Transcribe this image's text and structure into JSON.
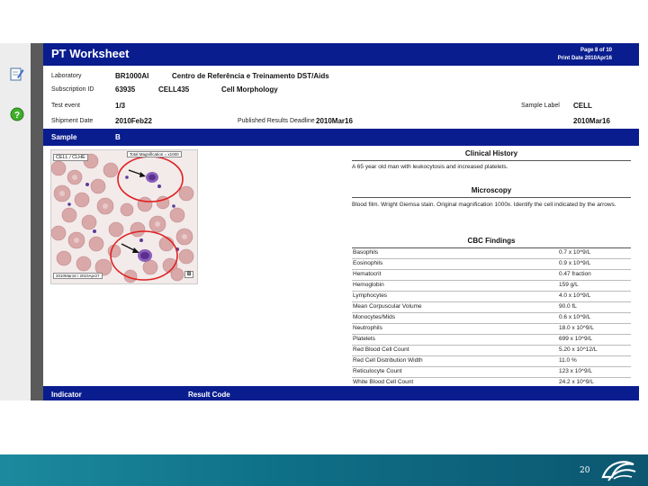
{
  "toolbar": {
    "icons": [
      "edit-icon",
      "help-icon"
    ]
  },
  "header": {
    "title": "PT Worksheet",
    "page": "Page 8 of 10",
    "print_date": "Print Date 2010Apr16"
  },
  "info": {
    "laboratory_label": "Laboratory",
    "laboratory_code": "BR1000AI",
    "laboratory_name": "Centro de Referência e Treinamento DST/Aids",
    "subscription_label": "Subscription ID",
    "subscription_id": "63935",
    "subscription_code": "CELL435",
    "subscription_name": "Cell Morphology",
    "test_event_label": "Test event",
    "test_event": "1/3",
    "sample_label_label": "Sample Label",
    "sample_label": "CELL",
    "shipment_label": "Shipment Date",
    "shipment_date": "2010Feb22",
    "deadline_label": "Published Results Deadline",
    "deadline": "2010Mar16",
    "deadline_right": "2010Mar16"
  },
  "sample_band": {
    "label": "Sample",
    "value": "B"
  },
  "image": {
    "tag": "CELL / CLHE",
    "magnification": "Total Magnification = x1000",
    "date_range": "2010Mar16 / 2010Apr27",
    "sample_letter": "B"
  },
  "clinical_history": {
    "heading": "Clinical History",
    "text": "A 65 year old man with leukocytosis and increased platelets."
  },
  "microscopy": {
    "heading": "Microscopy",
    "text": "Blood film. Wright Giemsa stain. Original magnification 1000x.  Identify the cell indicated by the arrows."
  },
  "cbc": {
    "heading": "CBC Findings",
    "rows": [
      {
        "name": "Basophils",
        "value": "0.7 x 10^9/L"
      },
      {
        "name": "Eosinophils",
        "value": "0.9 x 10^9/L"
      },
      {
        "name": "Hematocrit",
        "value": "0.47 fraction"
      },
      {
        "name": "Hemoglobin",
        "value": "159 g/L"
      },
      {
        "name": "Lymphocytes",
        "value": "4.0 x 10^9/L"
      },
      {
        "name": "Mean Corpuscular Volume",
        "value": "90.0 fL"
      },
      {
        "name": "Monocytes/Mids",
        "value": "0.6 x 10^9/L"
      },
      {
        "name": "Neutrophils",
        "value": "18.0 x 10^9/L"
      },
      {
        "name": "Platelets",
        "value": "699 x 10^9/L"
      },
      {
        "name": "Red Blood Cell Count",
        "value": "5.20 x 10^12/L"
      },
      {
        "name": "Red Cell Distribution Width",
        "value": "11.0 %"
      },
      {
        "name": "Reticulocyte Count",
        "value": "123 x 10^9/L"
      },
      {
        "name": "White Blood Cell Count",
        "value": "24.2 x 10^9/L"
      }
    ]
  },
  "results_band": {
    "indicator": "Indicator",
    "result_code": "Result Code"
  },
  "footer": {
    "page_number": "20"
  },
  "colors": {
    "header_blue": "#0a1d8f",
    "footer_teal": "#0e6f86",
    "circle_red": "#e02020"
  }
}
